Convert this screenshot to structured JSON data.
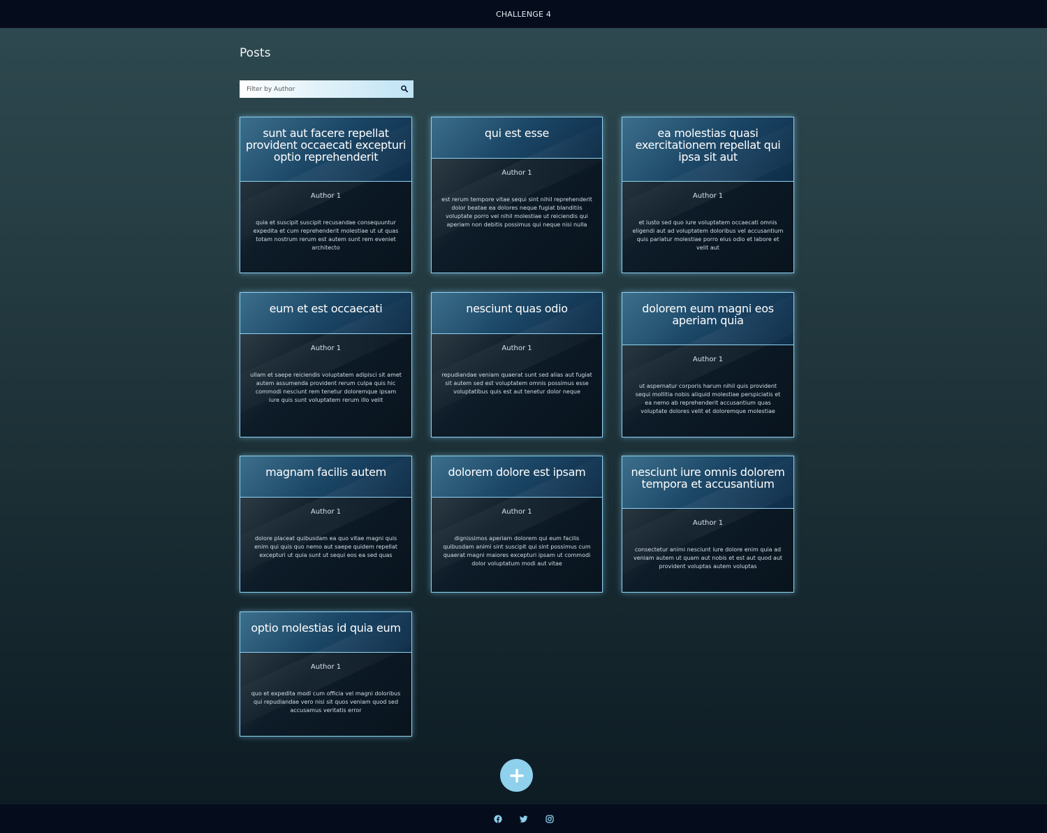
{
  "header": {
    "title": "CHALLENGE 4"
  },
  "page": {
    "title": "Posts"
  },
  "search": {
    "placeholder": "Filter by Author",
    "icon": "search-icon"
  },
  "colors": {
    "accent": "#8fd3f2",
    "bar": "#050c1c",
    "fab": "#8fd0ec"
  },
  "posts": [
    {
      "title": "sunt aut facere repellat provident occaecati excepturi optio reprehenderit",
      "author": "Author 1",
      "body": "quia et suscipit suscipit recusandae consequuntur expedita et cum reprehenderit molestiae ut ut quas totam nostrum rerum est autem sunt rem eveniet architecto"
    },
    {
      "title": "qui est esse",
      "author": "Author 1",
      "body": "est rerum tempore vitae sequi sint nihil reprehenderit dolor beatae ea dolores neque fugiat blanditiis voluptate porro vel nihil molestiae ut reiciendis qui aperiam non debitis possimus qui neque nisi nulla"
    },
    {
      "title": "ea molestias quasi exercitationem repellat qui ipsa sit aut",
      "author": "Author 1",
      "body": "et iusto sed quo iure voluptatem occaecati omnis eligendi aut ad voluptatem doloribus vel accusantium quis pariatur molestiae porro eius odio et labore et velit aut"
    },
    {
      "title": "eum et est occaecati",
      "author": "Author 1",
      "body": "ullam et saepe reiciendis voluptatem adipisci sit amet autem assumenda provident rerum culpa quis hic commodi nesciunt rem tenetur doloremque ipsam iure quis sunt voluptatem rerum illo velit"
    },
    {
      "title": "nesciunt quas odio",
      "author": "Author 1",
      "body": "repudiandae veniam quaerat sunt sed alias aut fugiat sit autem sed est voluptatem omnis possimus esse voluptatibus quis est aut tenetur dolor neque"
    },
    {
      "title": "dolorem eum magni eos aperiam quia",
      "author": "Author 1",
      "body": "ut aspernatur corporis harum nihil quis provident sequi mollitia nobis aliquid molestiae perspiciatis et ea nemo ab reprehenderit accusantium quas voluptate dolores velit et doloremque molestiae"
    },
    {
      "title": "magnam facilis autem",
      "author": "Author 1",
      "body": "dolore placeat quibusdam ea quo vitae magni quis enim qui quis quo nemo aut saepe quidem repellat excepturi ut quia sunt ut sequi eos ea sed quas"
    },
    {
      "title": "dolorem dolore est ipsam",
      "author": "Author 1",
      "body": "dignissimos aperiam dolorem qui eum facilis quibusdam animi sint suscipit qui sint possimus cum quaerat magni maiores excepturi ipsam ut commodi dolor voluptatum modi aut vitae"
    },
    {
      "title": "nesciunt iure omnis dolorem tempora et accusantium",
      "author": "Author 1",
      "body": "consectetur animi nesciunt iure dolore enim quia ad veniam autem ut quam aut nobis et est aut quod aut provident voluptas autem voluptas"
    },
    {
      "title": "optio molestias id quia eum",
      "author": "Author 1",
      "body": "quo et expedita modi cum officia vel magni doloribus qui repudiandae vero nisi sit quos veniam quod sed accusamus veritatis error"
    }
  ],
  "fab": {
    "icon": "plus-icon"
  },
  "footer": {
    "icons": [
      "facebook-icon",
      "twitter-icon",
      "instagram-icon"
    ]
  }
}
